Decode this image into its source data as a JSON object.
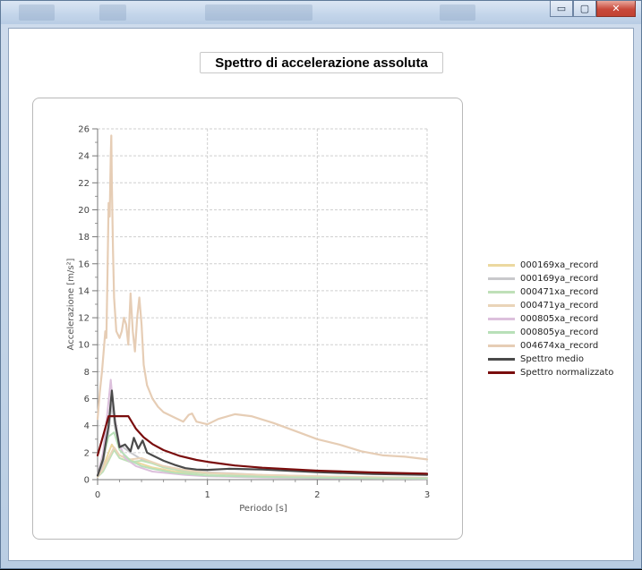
{
  "chart_title": "Spettro di accelerazione assoluta",
  "window": {
    "buttons": {
      "minimize": "▭",
      "maximize": "▢",
      "close": "✕"
    }
  },
  "chart_data": {
    "type": "line",
    "title": "Spettro di accelerazione assoluta",
    "xlabel": "Periodo [s]",
    "ylabel": "Accelerazione [m/s²]",
    "xlim": [
      0,
      3
    ],
    "ylim": [
      0,
      26
    ],
    "xticks": [
      0,
      1,
      2,
      3
    ],
    "yticks": [
      0,
      2,
      4,
      6,
      8,
      10,
      12,
      14,
      16,
      18,
      20,
      22,
      24,
      26
    ],
    "grid": true,
    "legend_position": "right",
    "series": [
      {
        "name": "000169xa_record",
        "color": "#ecd9a0",
        "width": 2,
        "x": [
          0,
          0.05,
          0.1,
          0.13,
          0.18,
          0.25,
          0.35,
          0.5,
          0.7,
          1.0,
          1.5,
          2.0,
          2.5,
          3.0
        ],
        "y": [
          0.2,
          0.9,
          2.0,
          2.6,
          1.9,
          1.6,
          1.3,
          0.9,
          0.6,
          0.45,
          0.3,
          0.22,
          0.16,
          0.12
        ]
      },
      {
        "name": "000169ya_record",
        "color": "#c9c9cc",
        "width": 2,
        "x": [
          0,
          0.05,
          0.1,
          0.13,
          0.16,
          0.2,
          0.3,
          0.4,
          0.6,
          0.8,
          1.0,
          1.5,
          2.0,
          2.5,
          3.0
        ],
        "y": [
          0.2,
          1.2,
          3.5,
          5.6,
          3.8,
          2.6,
          2.0,
          1.5,
          1.0,
          0.7,
          0.55,
          0.35,
          0.25,
          0.18,
          0.14
        ]
      },
      {
        "name": "000471xa_record",
        "color": "#bfe0b8",
        "width": 2,
        "x": [
          0,
          0.05,
          0.1,
          0.15,
          0.2,
          0.3,
          0.4,
          0.5,
          0.6,
          0.8,
          1.0,
          1.5,
          2.0,
          2.5,
          3.0
        ],
        "y": [
          0.2,
          0.6,
          1.4,
          2.2,
          1.6,
          1.3,
          1.4,
          1.2,
          0.9,
          0.6,
          0.45,
          0.3,
          0.2,
          0.15,
          0.1
        ]
      },
      {
        "name": "000471ya_record",
        "color": "#ead4b8",
        "width": 2,
        "x": [
          0,
          0.05,
          0.1,
          0.15,
          0.2,
          0.3,
          0.4,
          0.5,
          0.6,
          0.8,
          1.0,
          1.5,
          2.0,
          2.5,
          3.0
        ],
        "y": [
          0.2,
          0.8,
          1.6,
          2.4,
          1.8,
          1.5,
          1.6,
          1.3,
          1.0,
          0.7,
          0.5,
          0.35,
          0.25,
          0.18,
          0.12
        ]
      },
      {
        "name": "000805xa_record",
        "color": "#dcc0dc",
        "width": 2,
        "x": [
          0,
          0.05,
          0.09,
          0.12,
          0.15,
          0.2,
          0.25,
          0.35,
          0.5,
          0.8,
          1.0,
          1.5,
          2.0,
          2.5,
          3.0
        ],
        "y": [
          0.3,
          2.0,
          5.0,
          7.4,
          4.8,
          2.6,
          1.6,
          1.0,
          0.6,
          0.35,
          0.25,
          0.15,
          0.1,
          0.08,
          0.06
        ]
      },
      {
        "name": "000805ya_record",
        "color": "#b8e0b8",
        "width": 2,
        "x": [
          0,
          0.05,
          0.1,
          0.15,
          0.2,
          0.3,
          0.4,
          0.5,
          0.7,
          1.0,
          1.5,
          2.0,
          2.5,
          3.0
        ],
        "y": [
          0.3,
          1.6,
          3.2,
          3.5,
          2.2,
          1.4,
          1.0,
          0.8,
          0.5,
          0.3,
          0.2,
          0.15,
          0.1,
          0.08
        ]
      },
      {
        "name": "004674xa_record",
        "color": "#e6cdb5",
        "width": 2.2,
        "x": [
          0,
          0.02,
          0.04,
          0.06,
          0.07,
          0.08,
          0.09,
          0.1,
          0.11,
          0.12,
          0.125,
          0.13,
          0.14,
          0.15,
          0.17,
          0.2,
          0.22,
          0.24,
          0.26,
          0.28,
          0.3,
          0.32,
          0.34,
          0.36,
          0.38,
          0.4,
          0.42,
          0.45,
          0.5,
          0.55,
          0.6,
          0.7,
          0.78,
          0.83,
          0.86,
          0.9,
          1.0,
          1.1,
          1.25,
          1.4,
          1.6,
          1.8,
          2.0,
          2.2,
          2.4,
          2.6,
          2.8,
          3.0
        ],
        "y": [
          4.5,
          6.5,
          8.0,
          10.0,
          11.0,
          10.5,
          15.0,
          20.5,
          19.5,
          24.0,
          25.5,
          22.0,
          17.0,
          13.5,
          11.0,
          10.5,
          11.0,
          12.0,
          11.5,
          10.0,
          13.8,
          11.0,
          9.5,
          12.0,
          13.5,
          11.5,
          8.5,
          7.0,
          6.0,
          5.4,
          5.0,
          4.6,
          4.3,
          4.8,
          4.9,
          4.3,
          4.1,
          4.5,
          4.85,
          4.7,
          4.2,
          3.6,
          3.0,
          2.6,
          2.1,
          1.8,
          1.7,
          1.5
        ]
      },
      {
        "name": "Spettro medio",
        "color": "#4a4a4a",
        "width": 2.2,
        "x": [
          0,
          0.05,
          0.1,
          0.13,
          0.16,
          0.2,
          0.25,
          0.3,
          0.33,
          0.37,
          0.41,
          0.45,
          0.5,
          0.6,
          0.7,
          0.8,
          0.9,
          1.0,
          1.2,
          1.5,
          2.0,
          2.5,
          3.0
        ],
        "y": [
          0.3,
          1.5,
          4.0,
          6.6,
          4.2,
          2.4,
          2.6,
          2.1,
          3.1,
          2.3,
          2.9,
          2.0,
          1.8,
          1.4,
          1.1,
          0.85,
          0.75,
          0.72,
          0.8,
          0.75,
          0.55,
          0.42,
          0.35
        ]
      },
      {
        "name": "Spettro normalizzato",
        "color": "#7a0d0d",
        "width": 2.2,
        "x": [
          0,
          0.1,
          0.28,
          0.35,
          0.42,
          0.5,
          0.6,
          0.75,
          0.9,
          1.0,
          1.25,
          1.5,
          2.0,
          2.5,
          3.0
        ],
        "y": [
          1.8,
          4.7,
          4.7,
          3.76,
          3.13,
          2.63,
          2.19,
          1.75,
          1.46,
          1.32,
          1.05,
          0.88,
          0.66,
          0.53,
          0.44
        ]
      }
    ]
  }
}
